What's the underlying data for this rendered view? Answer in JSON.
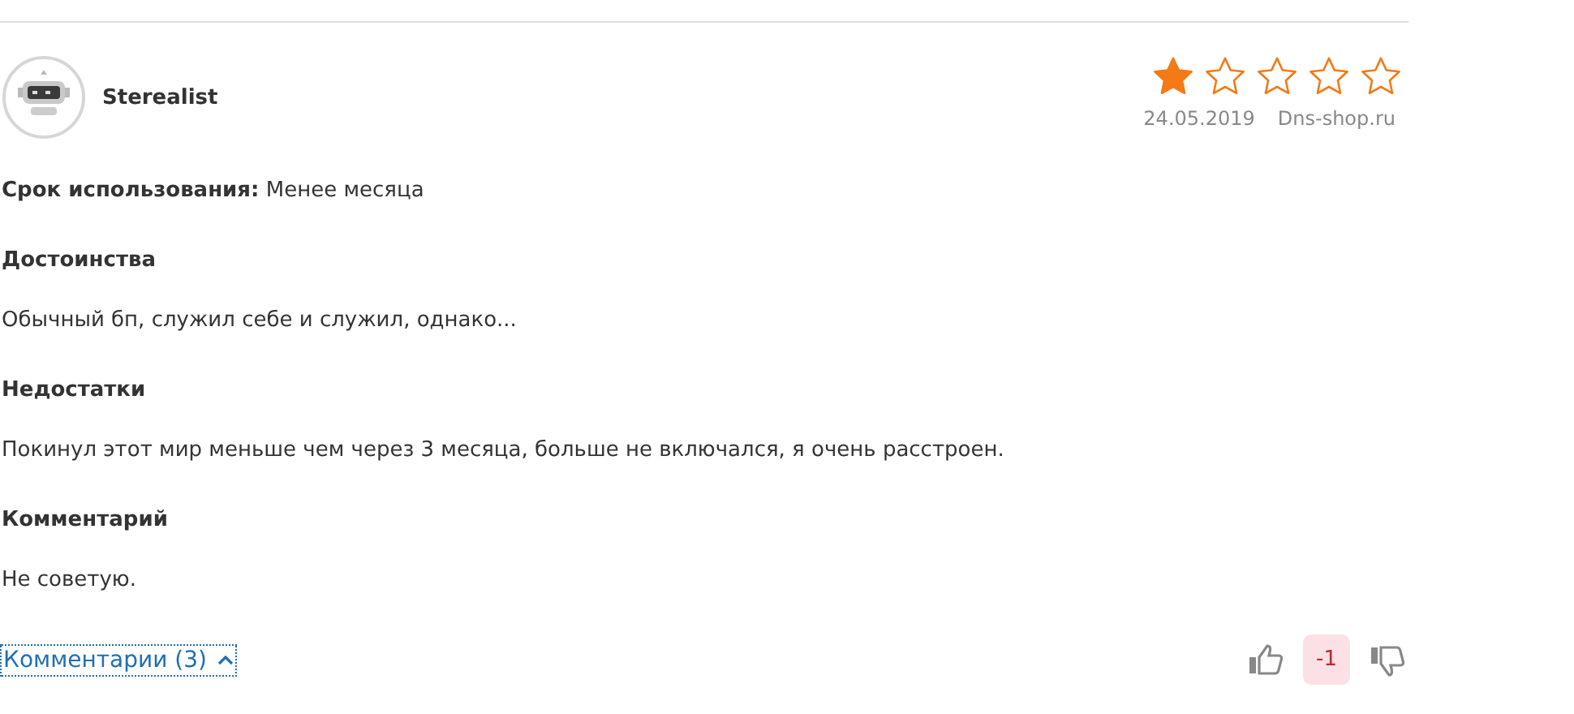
{
  "review": {
    "author": "Sterealist",
    "rating": {
      "stars": 1
    },
    "date": "24.05.2019",
    "source": "Dns-shop.ru",
    "usage": "**Срок использования:** Менее месяца",
    "sections": [
      {
        "heading": "Достоинства",
        "text": "Обычный бп, служил себе и служил, однако..."
      },
      {
        "heading": "Недостатки",
        "text": "Покинул этот мир меньше чем через 3 месяца, больше не включался, я очень расстроен."
      },
      {
        "heading": "Комментарий",
        "text": "Не советую."
      }
    ],
    "comments": {
      "label": "Комментарии (3)",
      "expanded": true
    },
    "votes": {
      "score": "-1"
    }
  }
}
